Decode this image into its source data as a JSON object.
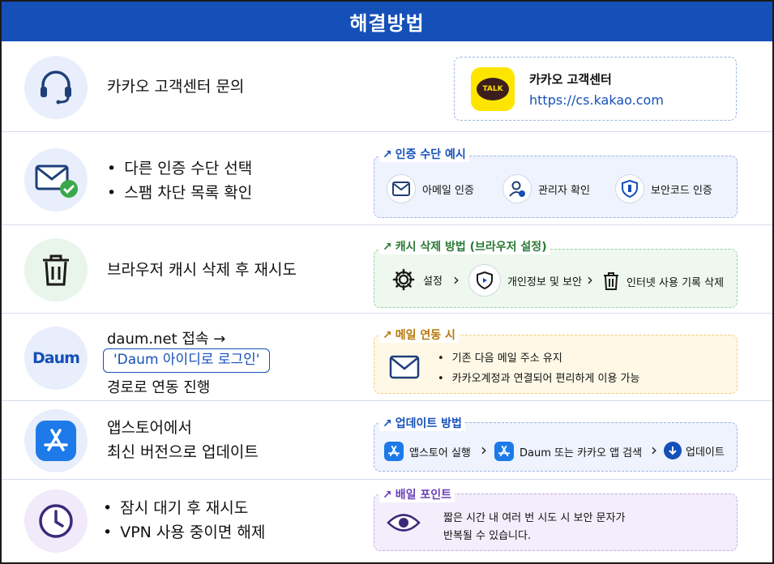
{
  "header": {
    "title": "해결방법"
  },
  "rows": {
    "r1": {
      "text": "카카오 고객센터 문의",
      "card": {
        "badge": "TALK",
        "name": "카카오 고객센터",
        "url": "https://cs.kakao.com"
      }
    },
    "r2": {
      "bullets": [
        "다른 인증 수단 선택",
        "스팸 차단 목록 확인"
      ],
      "panel_title": "인증 수단 예시",
      "items": [
        "아메일 인증",
        "관리자 확인",
        "보안코드 인증"
      ]
    },
    "r3": {
      "text": "브라우저 캐시 삭제 후 재시도",
      "panel_title": "캐시 삭제 방법 (브라우저 설정)",
      "items": [
        "설정",
        "개인정보 및 보안",
        "인터넷 사용 기록 삭제"
      ]
    },
    "r4": {
      "logo": "Daum",
      "line1": "daum.net 접속 →",
      "highlight": "'Daum 아이디로 로그인'",
      "line3": "경로로 연동 진행",
      "panel_title": "메일 연동 시",
      "bullets": [
        "기존 다음 메일 주소 유지",
        "카카오계정과 연결되어 편리하게 이용 가능"
      ]
    },
    "r5": {
      "line1": "앱스토어에서",
      "line2": "최신 버전으로 업데이트",
      "panel_title": "업데이트 방법",
      "items": [
        "앱스토어 실행",
        "Daum 또는 카카오 앱 검색",
        "업데이트"
      ]
    },
    "r6": {
      "bullets": [
        "잠시 대기 후 재시도",
        "VPN 사용 중이면 해제"
      ],
      "panel_title": "배일 포인트",
      "note_line1": "짧은 시간 내 여러 번 시도 시 보안 문자가",
      "note_line2": "반복될 수 있습니다."
    }
  },
  "colors": {
    "header": "#1550b8",
    "blue_panel": "#eef3fd",
    "green_panel": "#eef8ee",
    "yellow_panel": "#fff8e6",
    "purple_panel": "#f3eefb",
    "kakao_yellow": "#fee500",
    "check_green": "#3aa84a"
  },
  "icons": [
    "headset-icon",
    "mail-check-icon",
    "trash-icon",
    "daum-logo",
    "app-store-icon",
    "clock-icon",
    "talk-icon",
    "mail-icon",
    "user-check-icon",
    "shield-icon",
    "gear-icon",
    "eye-icon",
    "download-icon"
  ]
}
